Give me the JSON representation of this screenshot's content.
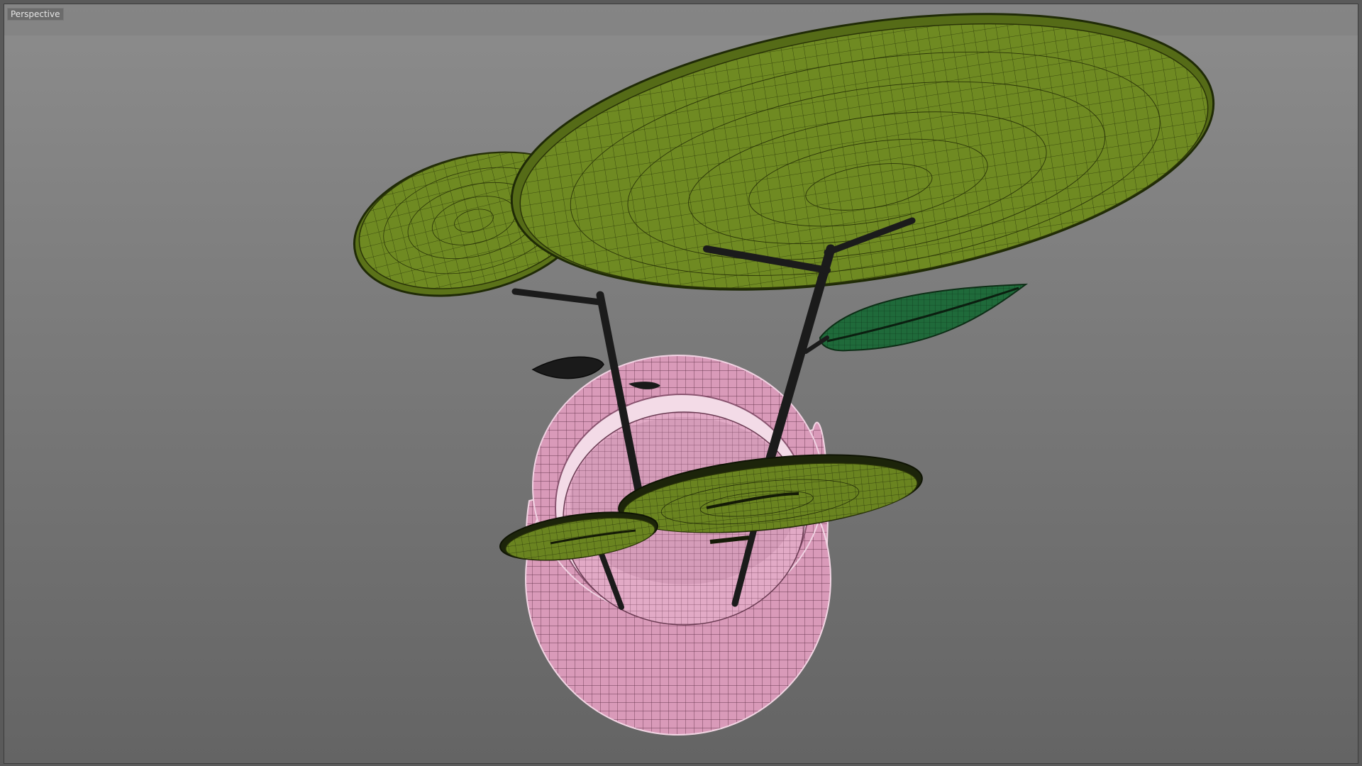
{
  "viewport": {
    "label": "Perspective"
  },
  "colors": {
    "pad": "#6f8a22",
    "pad_rim": "#4f6418",
    "wire": "#2a3408",
    "pot": "#d898b8",
    "pot_wire": "#6a3a52",
    "stem": "#1e1e1e",
    "leaf": "#1f6a3a"
  },
  "scene_objects": [
    "pot",
    "large-pad-right",
    "large-pad-left",
    "low-pad-center",
    "low-pad-left",
    "leaf-green",
    "leaf-dark",
    "stems"
  ]
}
